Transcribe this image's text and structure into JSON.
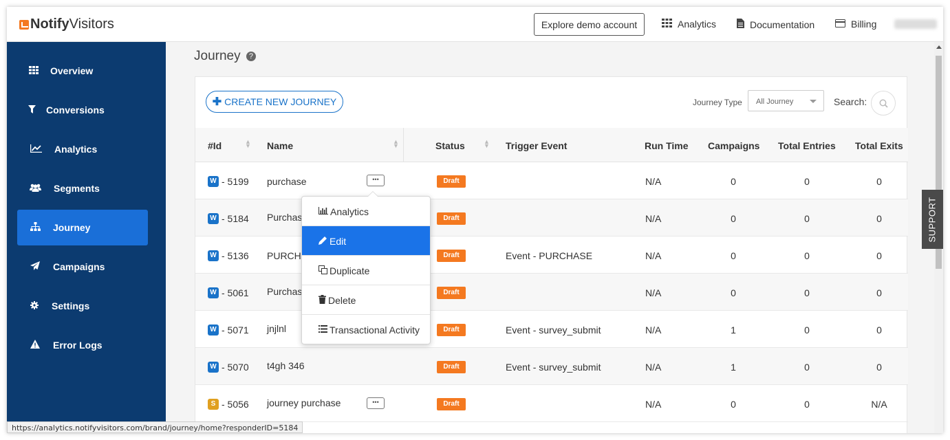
{
  "brand": {
    "name_part1": "Notify",
    "name_part2": "Visitors",
    "accent": "#f47920"
  },
  "topbar": {
    "demo_button": "Explore demo account",
    "links": [
      {
        "label": "Analytics",
        "icon": "grid-icon"
      },
      {
        "label": "Documentation",
        "icon": "document-icon"
      },
      {
        "label": "Billing",
        "icon": "credit-card-icon"
      }
    ]
  },
  "sidebar": {
    "items": [
      {
        "label": "Overview",
        "icon": "grid-icon",
        "active": false
      },
      {
        "label": "Conversions",
        "icon": "filter-icon",
        "active": false
      },
      {
        "label": "Analytics",
        "icon": "line-chart-icon",
        "active": false
      },
      {
        "label": "Segments",
        "icon": "users-icon",
        "active": false
      },
      {
        "label": "Journey",
        "icon": "sitemap-icon",
        "active": true
      },
      {
        "label": "Campaigns",
        "icon": "paper-plane-icon",
        "active": false
      },
      {
        "label": "Settings",
        "icon": "gear-icon",
        "active": false
      },
      {
        "label": "Error Logs",
        "icon": "warning-icon",
        "active": false
      }
    ],
    "background": "#0c3b70",
    "active_color": "#1a6fd8"
  },
  "page": {
    "title": "Journey",
    "help_icon": "?",
    "create_button": "CREATE NEW JOURNEY",
    "journey_type_label": "Journey Type",
    "journey_type_value": "All Journey",
    "search_label": "Search:"
  },
  "table": {
    "headers": [
      "#Id",
      "Name",
      "Status",
      "Trigger Event",
      "Run Time",
      "Campaigns",
      "Total Entries",
      "Total Exits"
    ],
    "rows": [
      {
        "badge": "W",
        "id": "- 5199",
        "name": "purchase",
        "status": "Draft",
        "trigger": "",
        "runtime": "N/A",
        "campaigns": "0",
        "entries": "0",
        "exits": "0"
      },
      {
        "badge": "W",
        "id": "- 5184",
        "name": "Purchase",
        "status": "Draft",
        "trigger": "",
        "runtime": "N/A",
        "campaigns": "0",
        "entries": "0",
        "exits": "0"
      },
      {
        "badge": "W",
        "id": "- 5136",
        "name": "PURCHA",
        "status": "Draft",
        "trigger": "Event - PURCHASE",
        "runtime": "N/A",
        "campaigns": "0",
        "entries": "0",
        "exits": "0"
      },
      {
        "badge": "W",
        "id": "- 5061",
        "name": "Purchase",
        "status": "Draft",
        "trigger": "",
        "runtime": "N/A",
        "campaigns": "0",
        "entries": "0",
        "exits": "0"
      },
      {
        "badge": "W",
        "id": "- 5071",
        "name": "jnjlnl",
        "status": "Draft",
        "trigger": "Event - survey_submit",
        "runtime": "N/A",
        "campaigns": "1",
        "entries": "0",
        "exits": "0"
      },
      {
        "badge": "W",
        "id": "- 5070",
        "name": "t4gh 346",
        "status": "Draft",
        "trigger": "Event - survey_submit",
        "runtime": "N/A",
        "campaigns": "1",
        "entries": "0",
        "exits": "0"
      },
      {
        "badge": "S",
        "id": "- 5056",
        "name": "journey purchase",
        "status": "Draft",
        "trigger": "",
        "runtime": "N/A",
        "campaigns": "0",
        "entries": "0",
        "exits": "N/A"
      }
    ]
  },
  "dropdown": {
    "items": [
      {
        "label": "Analytics",
        "icon": "bar-chart-icon"
      },
      {
        "label": "Edit",
        "icon": "pencil-icon"
      },
      {
        "label": "Duplicate",
        "icon": "copy-icon"
      },
      {
        "label": "Delete",
        "icon": "trash-icon"
      },
      {
        "label": "Transactional Activity",
        "icon": "list-icon"
      }
    ]
  },
  "support_label": "SUPPORT",
  "status_url": "https://analytics.notifyvisitors.com/brand/journey/home?responderID=5184"
}
